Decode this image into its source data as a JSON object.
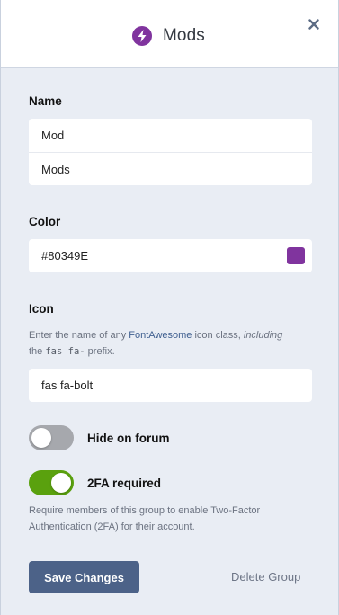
{
  "modal": {
    "title": "Mods",
    "icon": "bolt-icon",
    "close_icon": "close-icon"
  },
  "form": {
    "name": {
      "label": "Name",
      "singular_value": "Mod",
      "plural_value": "Mods"
    },
    "color": {
      "label": "Color",
      "value": "#80349E",
      "swatch_color": "#80349E"
    },
    "icon": {
      "label": "Icon",
      "help_prefix": "Enter the name of any ",
      "help_link": "FontAwesome",
      "help_middle": " icon class, ",
      "help_emphasis": "including",
      "help_line2_prefix": "the ",
      "help_code": "fas fa-",
      "help_suffix": " prefix.",
      "value": "fas fa-bolt"
    },
    "hide_on_forum": {
      "label": "Hide on forum",
      "enabled": false
    },
    "two_fa": {
      "label": "2FA required",
      "enabled": true,
      "help": "Require members of this group to enable Two-Factor Authentication (2FA) for their account."
    }
  },
  "actions": {
    "save_label": "Save Changes",
    "delete_label": "Delete Group"
  },
  "colors": {
    "primary_button": "#4c6288",
    "toggle_on": "#5aa10e",
    "toggle_off": "#a6a8ad",
    "background": "#e9edf4"
  }
}
